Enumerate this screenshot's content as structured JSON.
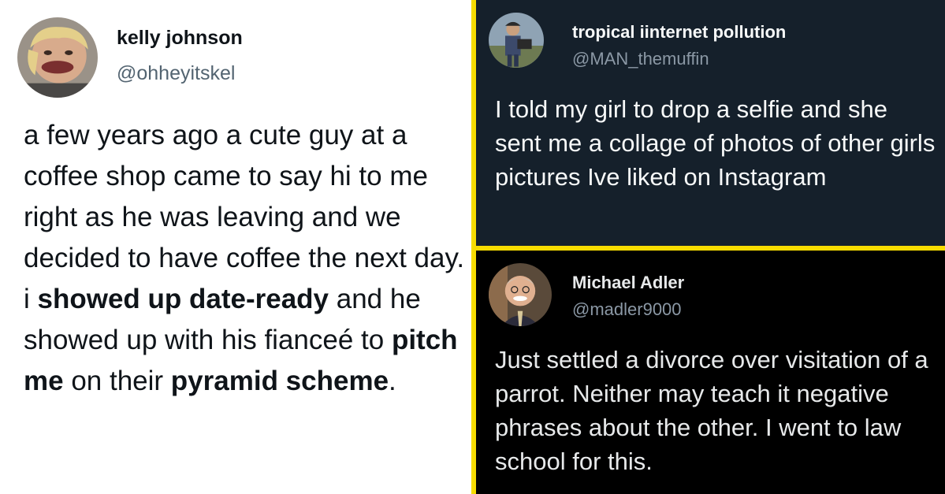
{
  "colors": {
    "divider": "#f7dc00",
    "left_bg": "#ffffff",
    "dim_bg": "#15202b",
    "dark_bg": "#000000"
  },
  "tweets": [
    {
      "name": "kelly johnson",
      "handle": "@ohheyitskel",
      "avatar_icon": "user-avatar-photo",
      "text": {
        "p1": "a few years ago a cute guy at a coffee shop came to say hi to me right as he was leaving and we decided to have coffee the next day. i ",
        "b1": "showed up date-ready",
        "p2": " and he showed up with his fianceé to ",
        "b2": "pitch me",
        "p3": " on their ",
        "b3": "pyramid scheme",
        "p4": "."
      }
    },
    {
      "name": "tropical iinternet pollution",
      "handle": "@MAN_themuffin",
      "avatar_icon": "user-avatar-photo",
      "text": "I told my girl to drop a selfie and she sent me a collage of photos of other girls pictures Ive liked on Instagram"
    },
    {
      "name": "Michael Adler",
      "handle": "@madler9000",
      "avatar_icon": "user-avatar-photo",
      "text": "Just settled a divorce over visitation of a parrot. Neither may teach it negative phrases about the other. I went to law school for this."
    }
  ]
}
